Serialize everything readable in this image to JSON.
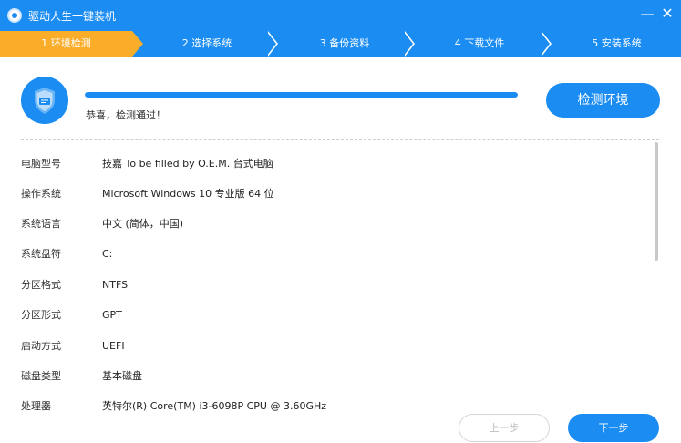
{
  "window": {
    "title": "驱动人生一键装机",
    "minimize_glyph": "—",
    "close_glyph": "✕"
  },
  "steps": [
    {
      "label": "1 环境检测",
      "active": true
    },
    {
      "label": "2 选择系统",
      "active": false
    },
    {
      "label": "3 备份资料",
      "active": false
    },
    {
      "label": "4 下载文件",
      "active": false
    },
    {
      "label": "5 安装系统",
      "active": false
    }
  ],
  "check": {
    "progress": 1.0,
    "status_text": "恭喜，检测通过！",
    "button_label": "检测环境"
  },
  "info": [
    {
      "label": "电脑型号",
      "value": "技嘉 To be filled by O.E.M. 台式电脑"
    },
    {
      "label": "操作系统",
      "value": "Microsoft Windows 10 专业版 64 位"
    },
    {
      "label": "系统语言",
      "value": "中文 (简体，中国)"
    },
    {
      "label": "系统盘符",
      "value": "C:"
    },
    {
      "label": "分区格式",
      "value": "NTFS"
    },
    {
      "label": "分区形式",
      "value": "GPT"
    },
    {
      "label": "启动方式",
      "value": "UEFI"
    },
    {
      "label": "磁盘类型",
      "value": "基本磁盘"
    },
    {
      "label": "处理器",
      "value": "英特尔(R) Core(TM) i3-6098P CPU @ 3.60GHz"
    }
  ],
  "footer": {
    "prev_label": "上一步",
    "next_label": "下一步"
  },
  "colors": {
    "primary": "#1a8cf2",
    "active_step": "#f9ad28"
  },
  "icons": {
    "app": "app-logo-icon",
    "shield": "shield-check-icon"
  }
}
